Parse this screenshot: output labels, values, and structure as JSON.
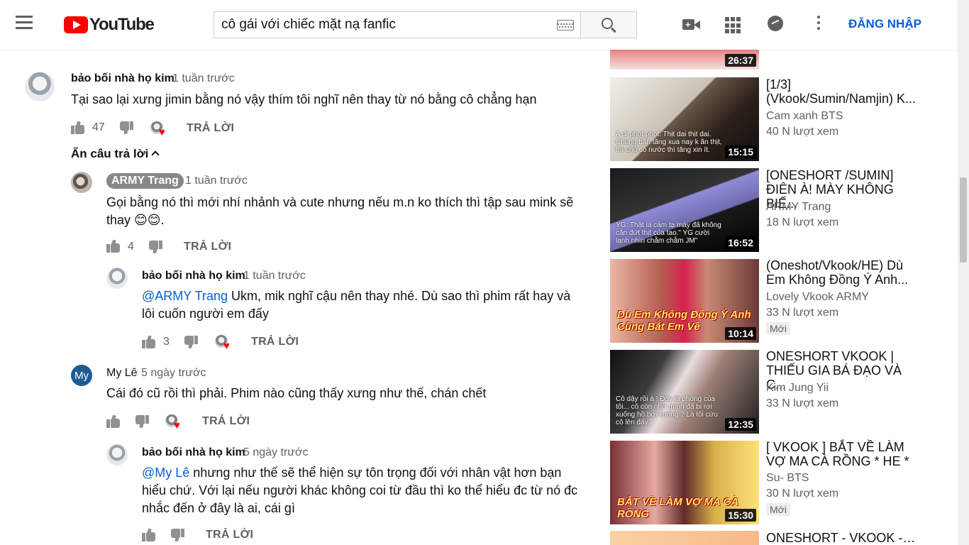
{
  "header": {
    "logo_text": "YouTube",
    "search_value": "cô gái với chiếc mặt nạ fanfic",
    "signin_label": "ĐĂNG NHẬP"
  },
  "comments": {
    "top": {
      "author": "bảo bối nhà họ kim",
      "time": "1 tuần trước",
      "text": "Tại sao lại xưng jimin bằng nó vậy thím tôi nghĩ nên thay từ nó bằng cô chẳng hạn",
      "likes": "47",
      "reply_label": "TRẢ LỜI",
      "toggle_label": "Ẩn câu trả lời"
    },
    "replies": [
      {
        "author": "ARMY Trang",
        "time": "1 tuần trước",
        "text": "Gọi bằng nó thì mới nhí nhảnh và cute nhưng nếu m.n ko thích thì tập sau mink sẽ thay 😊😊.",
        "likes": "4",
        "reply_label": "TRẢ LỜI"
      },
      {
        "author": "bảo bối nhà họ kim",
        "time": "1 tuần trước",
        "mention": "@ARMY Trang",
        "text": " Ukm, mik nghĩ cậu nên thay nhé. Dù sao thì phim rất hay và lôi cuốn người em đấy",
        "likes": "3",
        "reply_label": "TRẢ LỜI"
      },
      {
        "author": "My Lê",
        "avatar_letter": "My",
        "time": "5 ngày trước",
        "text": "Cái đó cũ rồi thì phải. Phim nào cũng thấy xưng như thế, chán chết",
        "reply_label": "TRẢ LỜI"
      },
      {
        "author": "bảo bối nhà họ kim",
        "time": "5 ngày trước",
        "mention": "@My Lê",
        "text": " nhưng như thế sẽ thể hiện sự tôn trọng đối với nhân vật hơn bạn hiểu chứ. Với lại nếu người khác không coi từ đầu thì ko thể hiểu đc từ nó đc nhắc đến ở đây là ai, cái gì",
        "reply_label": "TRẢ LỜI"
      }
    ]
  },
  "sidebar": {
    "videos": [
      {
        "duration": "26:37"
      },
      {
        "title": "[1/3] (Vkook/Sumin/Namjin) K...",
        "channel": "Cam xanh BTS",
        "views": "40 N lượt xem",
        "duration": "15:15",
        "caption": "A đi phọt phọt. Thịt dai thịt dai. Chúng bắn tăng xua nay k ăn thịt, thì chủ có nước thì tăng xin ít."
      },
      {
        "title": "[ONESHORT /SUMIN] ĐIÊN À! MÀY KHÔNG BIẾ...",
        "channel": "ARMY Trang",
        "views": "18 N lượt xem",
        "duration": "16:52",
        "caption": "YG: Thật là cảm tạ mày đã không cắn đứt thịt của tao.\" YG cười lạnh nhìn chằm chằm JM\""
      },
      {
        "title": "(Oneshot/Vkook/HE) Dù Em Không Đồng Ý Anh...",
        "channel": "Lovely Vkook ARMY",
        "views": "33 N lượt xem",
        "duration": "10:14",
        "badge": "Mới",
        "overlay": "Dù Em Không Đồng Ý Anh Cũng Bắt Em Về"
      },
      {
        "title": "ONESHORT VKOOK | THIẾU GIA BÁ ĐẠO VÀ C...",
        "channel": "Kim Jung Yii",
        "views": "33 N lượt xem",
        "duration": "12:35",
        "caption": "Cô dậy rồi à ! Đây là phòng của tôi... cô còn nhớ mình đã bị rơi xuống hồ bơi không ? Là tôi cứu cô lên đấy"
      },
      {
        "title": "[ VKOOK ] BẮT VỀ LÀM VỢ MA CÀ RỒNG * HE *",
        "channel": "Su- BTS",
        "views": "30 N lượt xem",
        "duration": "15:30",
        "badge": "Mới",
        "overlay": "BẮT VỀ LÀM VỢ MA CÀ RỒNG"
      },
      {
        "title": "ONESHORT - VKOOK - HE"
      }
    ]
  },
  "colors": {
    "accent": "#065fd4",
    "brand": "#ff0000"
  }
}
